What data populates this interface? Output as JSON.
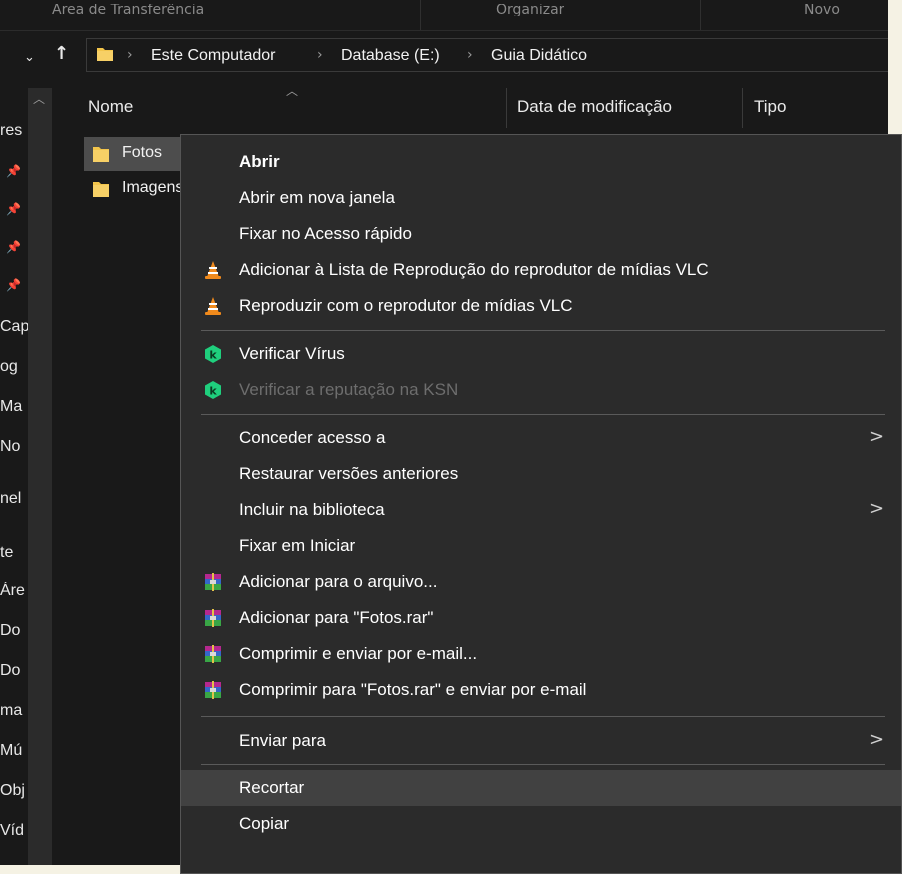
{
  "ribbon": {
    "groups": [
      "Área de Transferência",
      "Organizar",
      "Novo"
    ]
  },
  "navigation": {
    "back_icon": "chevron-down-icon",
    "up_icon": "up-arrow-icon",
    "breadcrumb": [
      "Este Computador",
      "Database (E:)",
      "Guia Didático"
    ]
  },
  "navpane": {
    "items": [
      "res",
      "Cap",
      "og",
      "Ma",
      "No",
      "nel",
      "te",
      "Áre",
      "Do",
      "Do",
      "ma",
      "Mú",
      "Obj",
      "Víd"
    ]
  },
  "columns": [
    "Nome",
    "Data de modificação",
    "Tipo"
  ],
  "files": [
    {
      "name": "Fotos",
      "selected": true
    },
    {
      "name": "Imagens",
      "selected": false
    }
  ],
  "context_menu": {
    "items": [
      {
        "label": "Abrir"
      },
      {
        "label": "Abrir em nova janela"
      },
      {
        "label": "Fixar no Acesso rápido"
      },
      {
        "label": "Adicionar à Lista de Reprodução do reprodutor de mídias VLC",
        "icon": "vlc-cone-icon"
      },
      {
        "label": "Reproduzir com o reprodutor de mídias VLC",
        "icon": "vlc-cone-icon"
      },
      {
        "label": "Verificar Vírus",
        "icon": "kaspersky-icon"
      },
      {
        "label": "Verificar a reputação na KSN",
        "icon": "kaspersky-icon",
        "disabled": true
      },
      {
        "label": "Conceder acesso a",
        "submenu": true
      },
      {
        "label": "Restaurar versões anteriores"
      },
      {
        "label": "Incluir na biblioteca",
        "submenu": true
      },
      {
        "label": "Fixar em Iniciar"
      },
      {
        "label": "Adicionar para o arquivo...",
        "icon": "winrar-icon"
      },
      {
        "label": "Adicionar para \"Fotos.rar\"",
        "icon": "winrar-icon"
      },
      {
        "label": "Comprimir e enviar por e-mail...",
        "icon": "winrar-icon"
      },
      {
        "label": "Comprimir para \"Fotos.rar\" e enviar por e-mail",
        "icon": "winrar-icon"
      },
      {
        "label": "Enviar para",
        "submenu": true
      },
      {
        "label": "Recortar",
        "highlighted": true
      },
      {
        "label": "Copiar"
      }
    ]
  },
  "colors": {
    "background": "#191919",
    "menu_background": "#2b2b2b",
    "menu_highlight": "#414141",
    "selection": "#4d4d4d",
    "folder_yellow": "#f3c54b",
    "kaspersky_green": "#1fcf7d",
    "vlc_orange": "#f08a1c"
  }
}
